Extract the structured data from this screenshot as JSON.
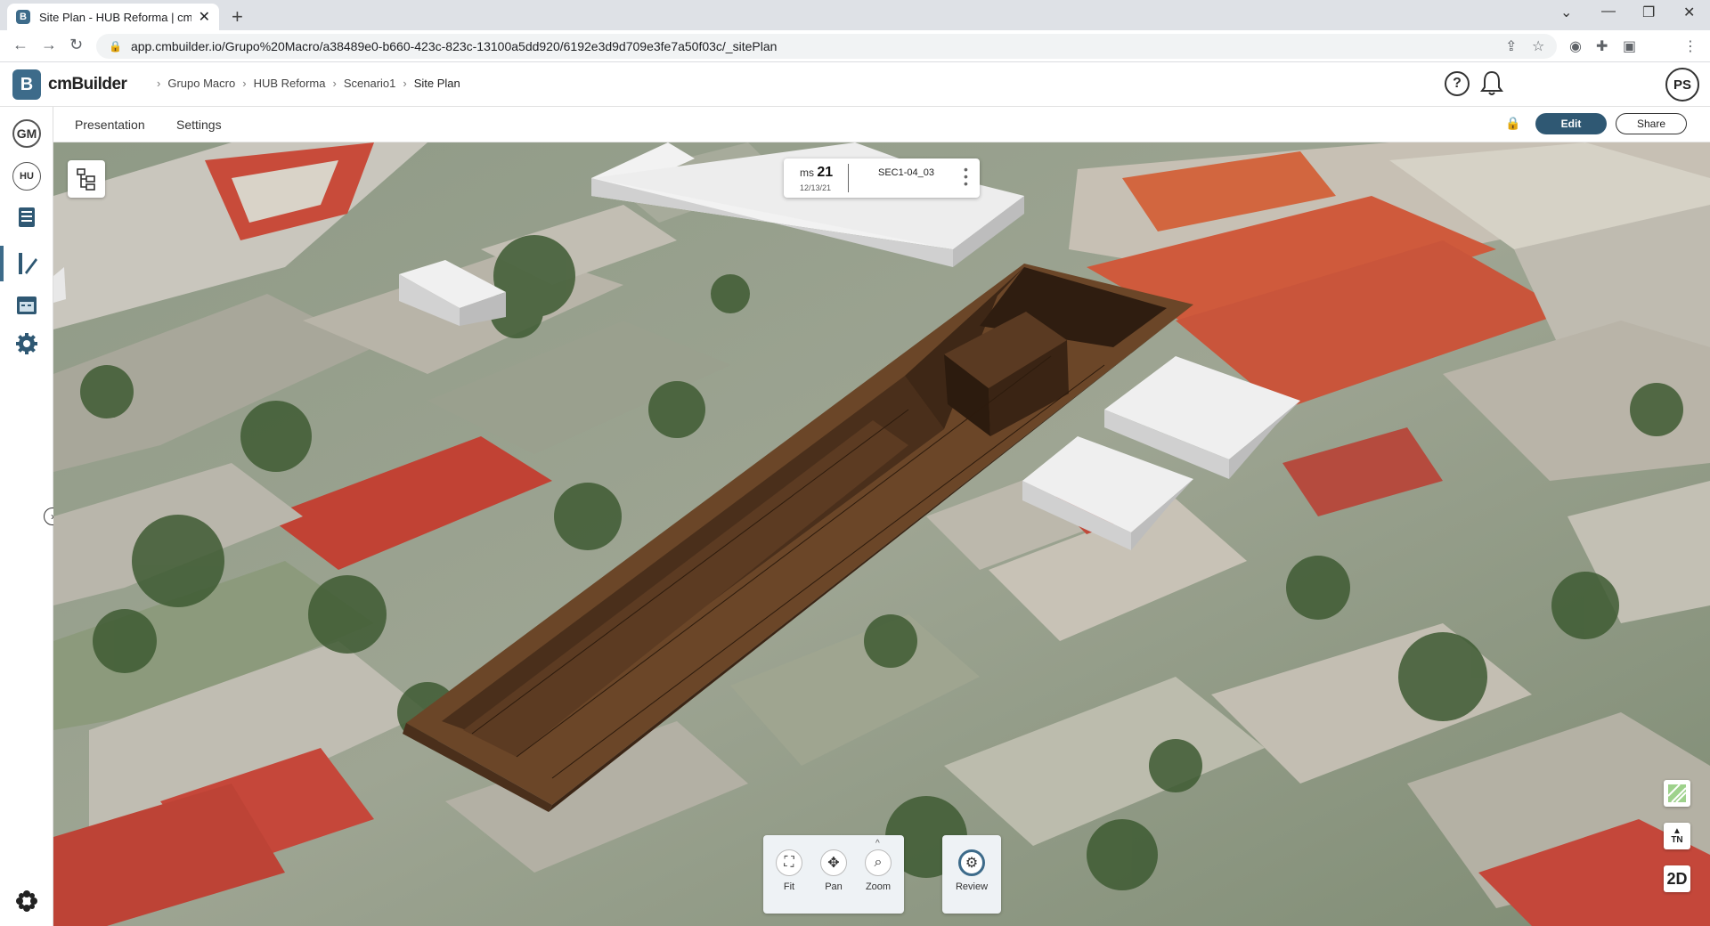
{
  "browser": {
    "tab_title": "Site Plan - HUB Reforma | cmBuil",
    "tab_favicon": "B",
    "url": "app.cmbuilder.io/Grupo%20Macro/a38489e0-b660-423c-823c-13100a5dd920/6192e3d9d709e3fe7a50f03c/_sitePlan"
  },
  "app": {
    "logo_mark": "B",
    "logo_name": "cmBuilder",
    "breadcrumbs": [
      "Grupo Macro",
      "HUB Reforma",
      "Scenario1",
      "Site Plan"
    ],
    "help_label": "?",
    "avatar_initials": "PS"
  },
  "rail": {
    "org_initials": "GM",
    "project_initials": "HU",
    "items": [
      "book-icon",
      "pencil-ruler-icon",
      "calendar-icon",
      "gear-icon"
    ],
    "bottom": "flower-icon"
  },
  "toolbar": {
    "tabs": [
      "Presentation",
      "Settings"
    ],
    "edit_label": "Edit",
    "share_label": "Share"
  },
  "infocard": {
    "ms_prefix": "ms",
    "ms_number": "21",
    "date": "12/13/21",
    "code": "SEC1-04_03"
  },
  "controls": {
    "fit": "Fit",
    "pan": "Pan",
    "zoom": "Zoom",
    "review": "Review"
  },
  "map_buttons": {
    "tn_top": "▲",
    "tn_label": "TN",
    "view_mode": "2D"
  },
  "colors": {
    "brand": "#3d6b8a",
    "edit_button": "#2f5873",
    "excavation": "#5a3a22"
  }
}
